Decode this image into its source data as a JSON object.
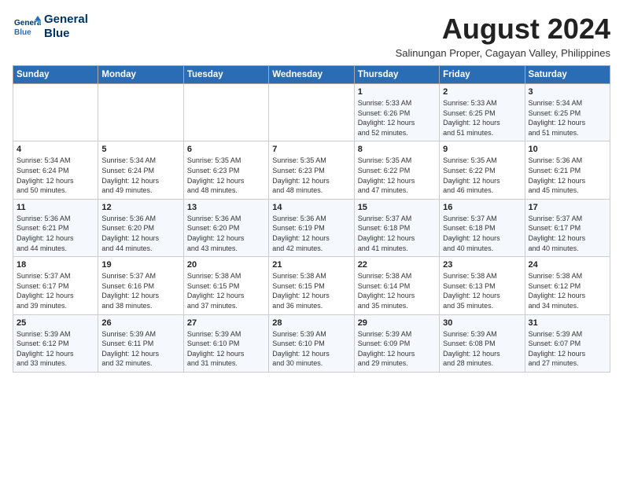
{
  "header": {
    "logo_line1": "General",
    "logo_line2": "Blue",
    "month_year": "August 2024",
    "location": "Salinungan Proper, Cagayan Valley, Philippines"
  },
  "weekdays": [
    "Sunday",
    "Monday",
    "Tuesday",
    "Wednesday",
    "Thursday",
    "Friday",
    "Saturday"
  ],
  "weeks": [
    [
      {
        "day": "",
        "info": ""
      },
      {
        "day": "",
        "info": ""
      },
      {
        "day": "",
        "info": ""
      },
      {
        "day": "",
        "info": ""
      },
      {
        "day": "1",
        "info": "Sunrise: 5:33 AM\nSunset: 6:26 PM\nDaylight: 12 hours\nand 52 minutes."
      },
      {
        "day": "2",
        "info": "Sunrise: 5:33 AM\nSunset: 6:25 PM\nDaylight: 12 hours\nand 51 minutes."
      },
      {
        "day": "3",
        "info": "Sunrise: 5:34 AM\nSunset: 6:25 PM\nDaylight: 12 hours\nand 51 minutes."
      }
    ],
    [
      {
        "day": "4",
        "info": "Sunrise: 5:34 AM\nSunset: 6:24 PM\nDaylight: 12 hours\nand 50 minutes."
      },
      {
        "day": "5",
        "info": "Sunrise: 5:34 AM\nSunset: 6:24 PM\nDaylight: 12 hours\nand 49 minutes."
      },
      {
        "day": "6",
        "info": "Sunrise: 5:35 AM\nSunset: 6:23 PM\nDaylight: 12 hours\nand 48 minutes."
      },
      {
        "day": "7",
        "info": "Sunrise: 5:35 AM\nSunset: 6:23 PM\nDaylight: 12 hours\nand 48 minutes."
      },
      {
        "day": "8",
        "info": "Sunrise: 5:35 AM\nSunset: 6:22 PM\nDaylight: 12 hours\nand 47 minutes."
      },
      {
        "day": "9",
        "info": "Sunrise: 5:35 AM\nSunset: 6:22 PM\nDaylight: 12 hours\nand 46 minutes."
      },
      {
        "day": "10",
        "info": "Sunrise: 5:36 AM\nSunset: 6:21 PM\nDaylight: 12 hours\nand 45 minutes."
      }
    ],
    [
      {
        "day": "11",
        "info": "Sunrise: 5:36 AM\nSunset: 6:21 PM\nDaylight: 12 hours\nand 44 minutes."
      },
      {
        "day": "12",
        "info": "Sunrise: 5:36 AM\nSunset: 6:20 PM\nDaylight: 12 hours\nand 44 minutes."
      },
      {
        "day": "13",
        "info": "Sunrise: 5:36 AM\nSunset: 6:20 PM\nDaylight: 12 hours\nand 43 minutes."
      },
      {
        "day": "14",
        "info": "Sunrise: 5:36 AM\nSunset: 6:19 PM\nDaylight: 12 hours\nand 42 minutes."
      },
      {
        "day": "15",
        "info": "Sunrise: 5:37 AM\nSunset: 6:18 PM\nDaylight: 12 hours\nand 41 minutes."
      },
      {
        "day": "16",
        "info": "Sunrise: 5:37 AM\nSunset: 6:18 PM\nDaylight: 12 hours\nand 40 minutes."
      },
      {
        "day": "17",
        "info": "Sunrise: 5:37 AM\nSunset: 6:17 PM\nDaylight: 12 hours\nand 40 minutes."
      }
    ],
    [
      {
        "day": "18",
        "info": "Sunrise: 5:37 AM\nSunset: 6:17 PM\nDaylight: 12 hours\nand 39 minutes."
      },
      {
        "day": "19",
        "info": "Sunrise: 5:37 AM\nSunset: 6:16 PM\nDaylight: 12 hours\nand 38 minutes."
      },
      {
        "day": "20",
        "info": "Sunrise: 5:38 AM\nSunset: 6:15 PM\nDaylight: 12 hours\nand 37 minutes."
      },
      {
        "day": "21",
        "info": "Sunrise: 5:38 AM\nSunset: 6:15 PM\nDaylight: 12 hours\nand 36 minutes."
      },
      {
        "day": "22",
        "info": "Sunrise: 5:38 AM\nSunset: 6:14 PM\nDaylight: 12 hours\nand 35 minutes."
      },
      {
        "day": "23",
        "info": "Sunrise: 5:38 AM\nSunset: 6:13 PM\nDaylight: 12 hours\nand 35 minutes."
      },
      {
        "day": "24",
        "info": "Sunrise: 5:38 AM\nSunset: 6:12 PM\nDaylight: 12 hours\nand 34 minutes."
      }
    ],
    [
      {
        "day": "25",
        "info": "Sunrise: 5:39 AM\nSunset: 6:12 PM\nDaylight: 12 hours\nand 33 minutes."
      },
      {
        "day": "26",
        "info": "Sunrise: 5:39 AM\nSunset: 6:11 PM\nDaylight: 12 hours\nand 32 minutes."
      },
      {
        "day": "27",
        "info": "Sunrise: 5:39 AM\nSunset: 6:10 PM\nDaylight: 12 hours\nand 31 minutes."
      },
      {
        "day": "28",
        "info": "Sunrise: 5:39 AM\nSunset: 6:10 PM\nDaylight: 12 hours\nand 30 minutes."
      },
      {
        "day": "29",
        "info": "Sunrise: 5:39 AM\nSunset: 6:09 PM\nDaylight: 12 hours\nand 29 minutes."
      },
      {
        "day": "30",
        "info": "Sunrise: 5:39 AM\nSunset: 6:08 PM\nDaylight: 12 hours\nand 28 minutes."
      },
      {
        "day": "31",
        "info": "Sunrise: 5:39 AM\nSunset: 6:07 PM\nDaylight: 12 hours\nand 27 minutes."
      }
    ]
  ]
}
